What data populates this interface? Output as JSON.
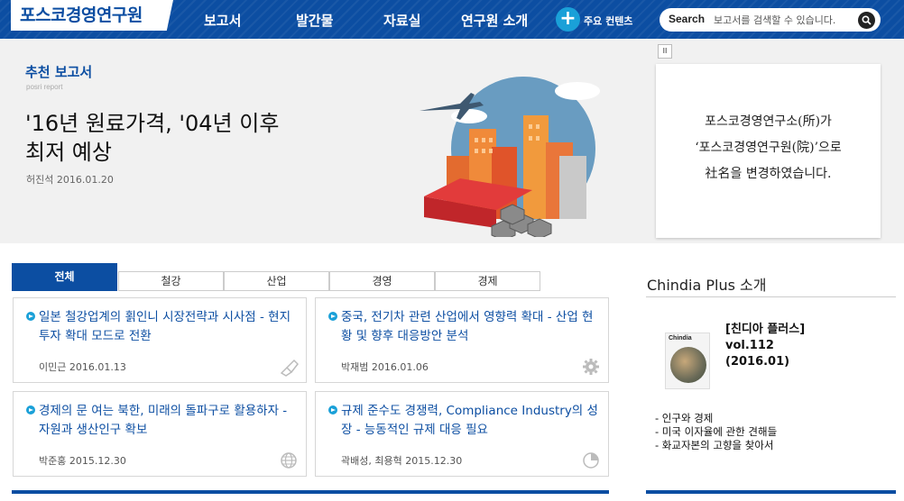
{
  "header": {
    "logo": "포스코경영연구원",
    "nav": [
      "보고서",
      "발간물",
      "자료실",
      "연구원 소개"
    ],
    "key_contents_label": "주요 컨텐츠",
    "search": {
      "label": "Search",
      "placeholder": "보고서를 검색할 수 있습니다."
    }
  },
  "banner": {
    "section_title": "추천 보고서",
    "section_sub": "posri report",
    "headline_line1": "'16년 원료가격, '04년 이후",
    "headline_line2": "최저 예상",
    "byline": "허진석 2016.01.20",
    "pause_label": "II",
    "notice": {
      "line1": "포스코경영연구소(所)가",
      "line2": "‘포스코경영연구원(院)’으로",
      "line3": "社名을 변경하였습니다."
    }
  },
  "tabs": [
    "전체",
    "철강",
    "산업",
    "경영",
    "경제"
  ],
  "active_tab": 0,
  "cards": [
    {
      "title": "일본 철강업계의 횕인니 시장전략과 시사점 - 현지투자 확대 모드로 전환",
      "meta": "이민근 2016.01.13",
      "icon": "steel-icon"
    },
    {
      "title": "중국, 전기차 관련 산업에서 영향력 확대 - 산업 현황 및 향후 대응방안 분석",
      "meta": "박재범 2016.01.06",
      "icon": "gear-icon"
    },
    {
      "title": "경제의 문 여는 북한, 미래의 돌파구로 활용하자 - 자원과 생산인구 확보",
      "meta": "박준홍 2015.12.30",
      "icon": "globe-icon"
    },
    {
      "title": "규제 준수도 경쟁력, Compliance Industry의 성장 - 능동적인 규제 대응 필요",
      "meta": "곽배성, 최용혁 2015.12.30",
      "icon": "pie-chart-icon"
    }
  ],
  "chindia": {
    "title": "Chindia Plus 소개",
    "magazine_head": "Chindia",
    "issue_line1": "[친디아 플러스]",
    "issue_line2": "vol.112",
    "issue_line3": "(2016.01)",
    "topics": [
      "- 인구와 경제",
      "- 미국 이자율에 관한 견해들",
      "- 화교자본의 고향을 찾아서"
    ]
  },
  "colors": {
    "brand": "#0c4ea2",
    "accent": "#1aa0d8"
  }
}
